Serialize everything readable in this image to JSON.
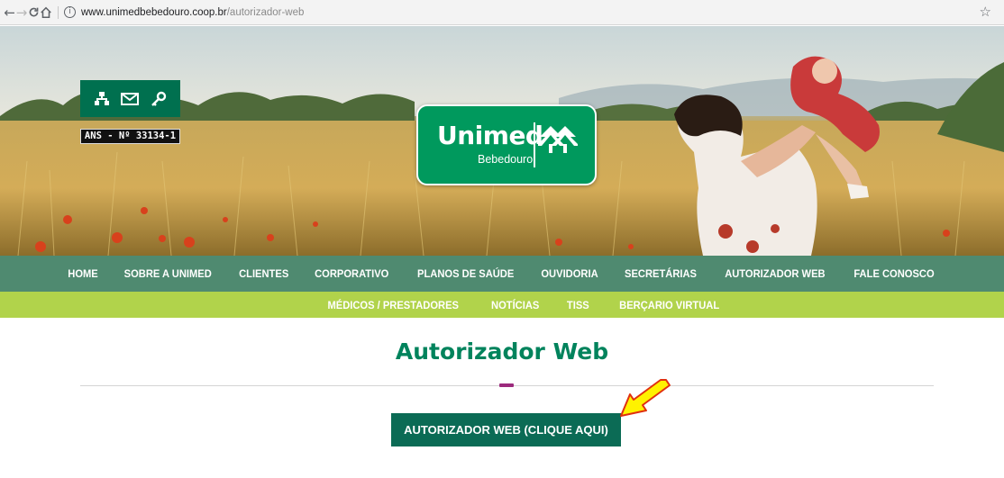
{
  "browser": {
    "back_icon": "←",
    "forward_icon": "→",
    "reload_icon": "C",
    "home_icon": "⌂",
    "url_host": "www.unimedbebedouro.coop.br",
    "url_path": "/autorizador-web",
    "star_icon": "☆"
  },
  "header": {
    "ans_label": "ANS - Nº 33134-1",
    "logo": {
      "brand": "Unimed",
      "unit": "Bebedouro"
    },
    "icons": [
      "sitemap-icon",
      "mail-icon",
      "key-icon"
    ]
  },
  "nav": {
    "items": [
      "HOME",
      "SOBRE A UNIMED",
      "CLIENTES",
      "CORPORATIVO",
      "PLANOS DE SAÚDE",
      "OUVIDORIA",
      "SECRETÁRIAS",
      "AUTORIZADOR WEB",
      "FALE CONOSCO"
    ]
  },
  "subnav": {
    "items": [
      "MÉDICOS / PRESTADORES",
      "NOTÍCIAS",
      "TISS",
      "BERÇARIO VIRTUAL"
    ]
  },
  "main": {
    "title": "Autorizador Web",
    "cta_label": "AUTORIZADOR WEB (CLIQUE AQUI)"
  },
  "colors": {
    "brand_green": "#00995d",
    "nav_green": "#4f8a70",
    "subnav_lime": "#b1d34b",
    "cta_green": "#0b6b55",
    "accent_purple": "#9c2a7d",
    "arrow_yellow": "#fff200"
  }
}
